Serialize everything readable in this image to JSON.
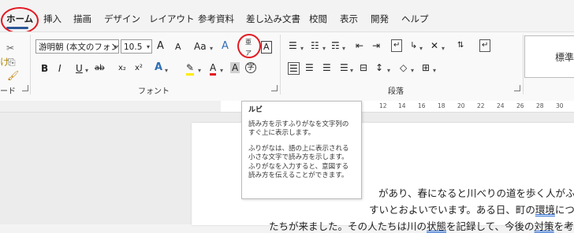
{
  "tabs": [
    "ホーム",
    "挿入",
    "描画",
    "デザイン",
    "レイアウト",
    "参考資料",
    "差し込み文書",
    "校閲",
    "表示",
    "開発",
    "ヘルプ"
  ],
  "clipboard": {
    "label": "ード",
    "paste_hint": "け"
  },
  "font": {
    "name": "游明朝 (本文のフォン",
    "size": "10.5",
    "grow": "A",
    "shrink": "A",
    "case": "Aa",
    "bold": "B",
    "italic": "I",
    "underline": "U",
    "strike": "ab",
    "subscript": "x₂",
    "superscript": "x²",
    "label": "フォント"
  },
  "paragraph": {
    "label": "段落"
  },
  "styles": {
    "preview": "標準"
  },
  "tooltip": {
    "title": "ルビ",
    "line1": "読み方を示すふりがなを文字列のすぐ上に表示します。",
    "line2": "ふりがなは、語の上に表示される小さな文字で読み方を示します。ふりがなを入力すると、意図する読み方を伝えることができます。"
  },
  "ruler": [
    "12",
    "14",
    "16",
    "18",
    "20",
    "22",
    "24",
    "26",
    "28",
    "30"
  ],
  "document": {
    "line1": "があり、春になると川べりの道を歩く人がふえ",
    "line2a": "すいとおよいでいます。ある日、町の",
    "line2b": "環境",
    "line2c": "につ",
    "line3a": "たちが来ました。その人たちは川の",
    "line3b": "状態",
    "line3c": "を記録して、今後の",
    "line3d": "対策",
    "line3e": "を考え"
  }
}
